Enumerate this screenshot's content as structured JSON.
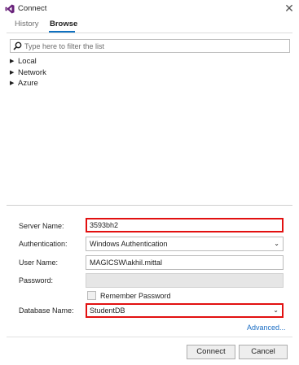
{
  "window": {
    "title": "Connect",
    "close_icon": "close-icon",
    "app_icon": "visual-studio-icon"
  },
  "tabs": [
    {
      "label": "History",
      "active": false
    },
    {
      "label": "Browse",
      "active": true
    }
  ],
  "browse": {
    "filter_placeholder": "Type here to filter the list",
    "filter_value": "",
    "tree": [
      {
        "label": "Local"
      },
      {
        "label": "Network"
      },
      {
        "label": "Azure"
      }
    ]
  },
  "form": {
    "server_name_label": "Server Name:",
    "server_name_value": "3593bh2",
    "authentication_label": "Authentication:",
    "authentication_value": "Windows Authentication",
    "user_name_label": "User Name:",
    "user_name_value": "MAGICSW\\akhil.mittal",
    "password_label": "Password:",
    "password_value": "",
    "remember_password_label": "Remember Password",
    "remember_password_checked": false,
    "database_name_label": "Database Name:",
    "database_name_value": "StudentDB",
    "advanced_link": "Advanced..."
  },
  "buttons": {
    "connect": "Connect",
    "cancel": "Cancel"
  },
  "colors": {
    "accent": "#0e70c0",
    "highlight": "#e21010",
    "link": "#1a6dc4"
  }
}
